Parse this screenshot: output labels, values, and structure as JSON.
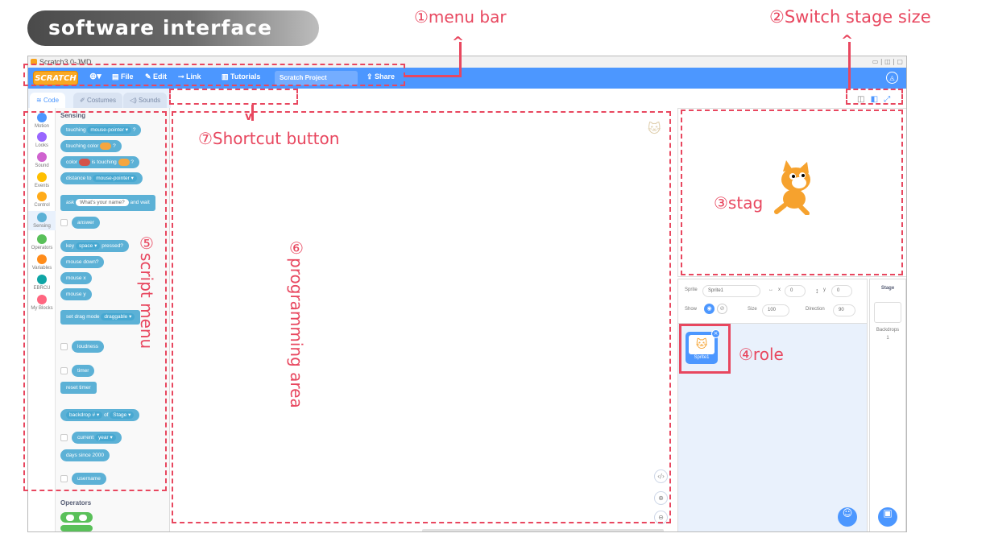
{
  "header": {
    "title": "software interface"
  },
  "callouts": {
    "menu_bar": "①menu bar",
    "switch_stage_size": "②Switch stage size",
    "stage": "③stag",
    "role": "④role",
    "script_menu": "⑤script menu",
    "programming_area": "⑥programming area",
    "shortcut_button": "⑦Shortcut button"
  },
  "window": {
    "title": "Scratch3.0-JMD"
  },
  "menu": {
    "logo": "SCRATCH",
    "file": "File",
    "edit": "Edit",
    "link": "Link",
    "tutorials": "Tutorials",
    "project_name": "Scratch Project",
    "share": "Share"
  },
  "tabs": {
    "code": "Code",
    "costumes": "Costumes",
    "sounds": "Sounds"
  },
  "categories": [
    {
      "label": "Motion",
      "color": "#4c97ff"
    },
    {
      "label": "Looks",
      "color": "#9966ff"
    },
    {
      "label": "Sound",
      "color": "#cf63cf"
    },
    {
      "label": "Events",
      "color": "#ffbf00"
    },
    {
      "label": "Control",
      "color": "#ffab19"
    },
    {
      "label": "Sensing",
      "color": "#5cb1d6"
    },
    {
      "label": "Operators",
      "color": "#59c059"
    },
    {
      "label": "Variables",
      "color": "#ff8c1a"
    },
    {
      "label": "EBRCU",
      "color": "#0fa5a5"
    },
    {
      "label": "My Blocks",
      "color": "#ff6680"
    }
  ],
  "palette": {
    "section_sensing": "Sensing",
    "touching": "touching",
    "mouse_pointer": "mouse-pointer",
    "touching_color": "touching color",
    "color": "color",
    "is_touching": "is touching",
    "distance_to": "distance to",
    "ask": "ask",
    "ask_default": "What's your name?",
    "and_wait": "and wait",
    "answer": "answer",
    "key": "key",
    "space": "space",
    "pressed": "pressed?",
    "mouse_down": "mouse down?",
    "mouse_x": "mouse x",
    "mouse_y": "mouse y",
    "set_drag_mode": "set drag mode",
    "draggable": "draggable",
    "loudness": "loudness",
    "timer": "timer",
    "reset_timer": "reset timer",
    "backdrop": "backdrop #",
    "of": "of",
    "stage": "Stage",
    "current": "current",
    "year": "year",
    "days_since": "days since 2000",
    "username": "username",
    "section_operators": "Operators"
  },
  "sprite_info": {
    "sprite_label": "Sprite",
    "sprite_name": "Sprite1",
    "x_label": "x",
    "x_value": "0",
    "y_label": "y",
    "y_value": "0",
    "show_label": "Show",
    "size_label": "Size",
    "size_value": "100",
    "direction_label": "Direction",
    "direction_value": "90"
  },
  "sprite_tile": {
    "name": "Sprite1"
  },
  "stage_panel": {
    "title": "Stage",
    "backdrops_label": "Backdrops",
    "backdrops_count": "1"
  }
}
